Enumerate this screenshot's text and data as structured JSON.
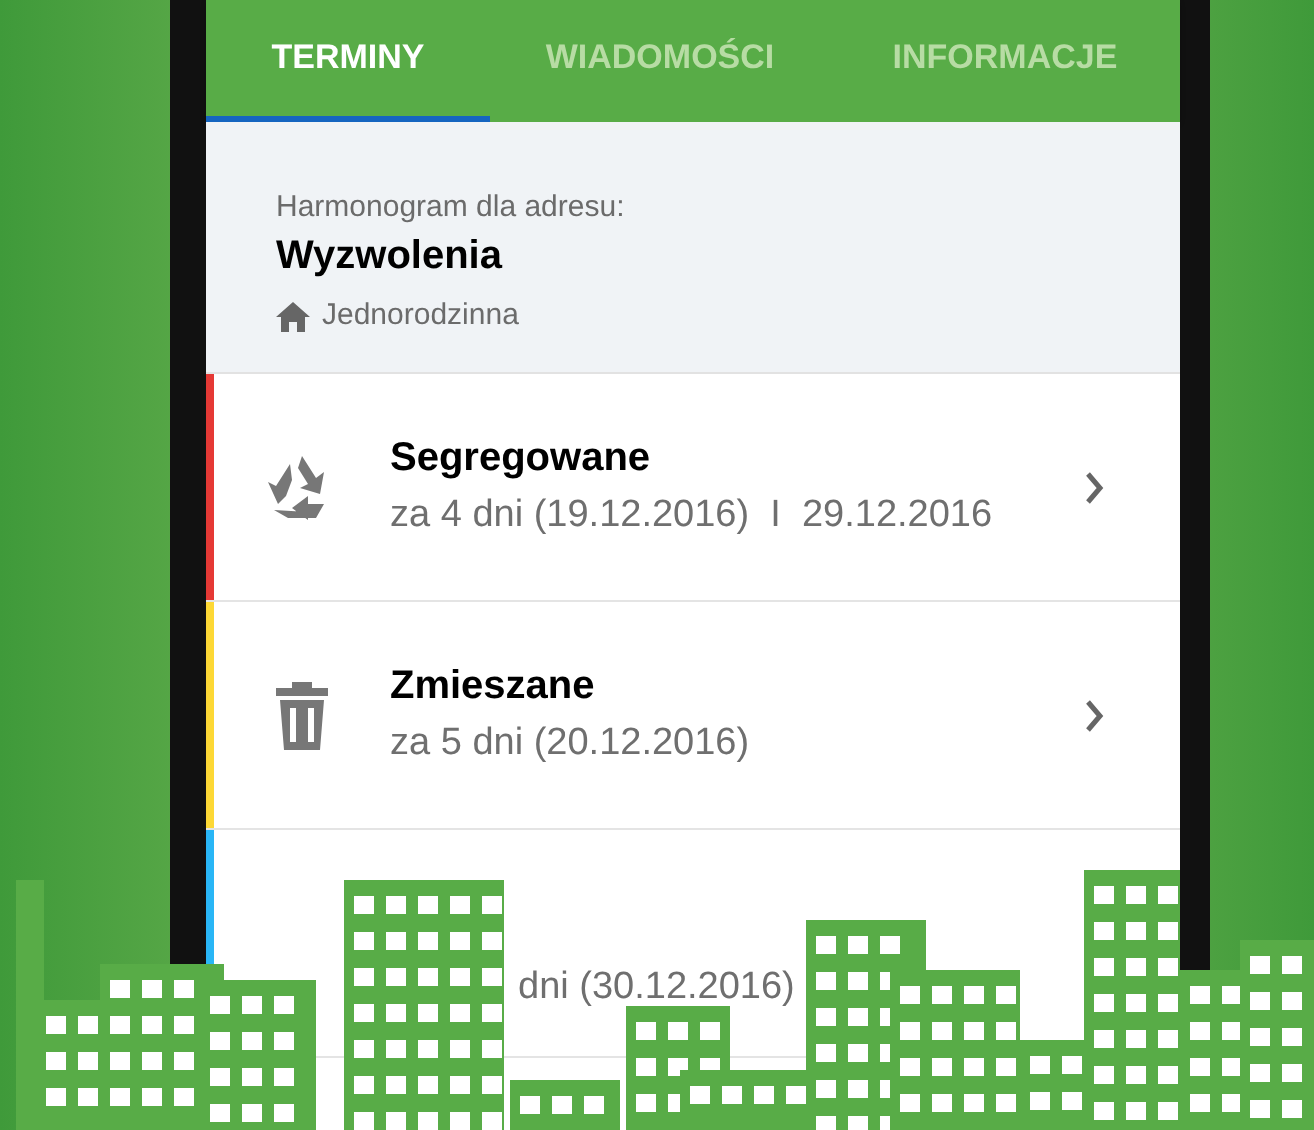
{
  "tabs": [
    {
      "label": "TERMINY",
      "selected": true
    },
    {
      "label": "WIADOMOŚCI",
      "selected": false
    },
    {
      "label": "INFORMACJE",
      "selected": false
    }
  ],
  "address": {
    "caption": "Harmonogram dla adresu:",
    "street": "Wyzwolenia",
    "building_type": "Jednorodzinna"
  },
  "schedule": [
    {
      "kind": "recycle",
      "color": "#e53935",
      "title": "Segregowane",
      "subtitle": "za 4 dni (19.12.2016)  I  29.12.2016"
    },
    {
      "kind": "bin",
      "color": "#fdd835",
      "title": "Zmieszane",
      "subtitle": "za 5 dni (20.12.2016)"
    },
    {
      "kind": "hidden",
      "color": "#29b6f6",
      "subtitle": "dni (30.12.2016)"
    }
  ]
}
